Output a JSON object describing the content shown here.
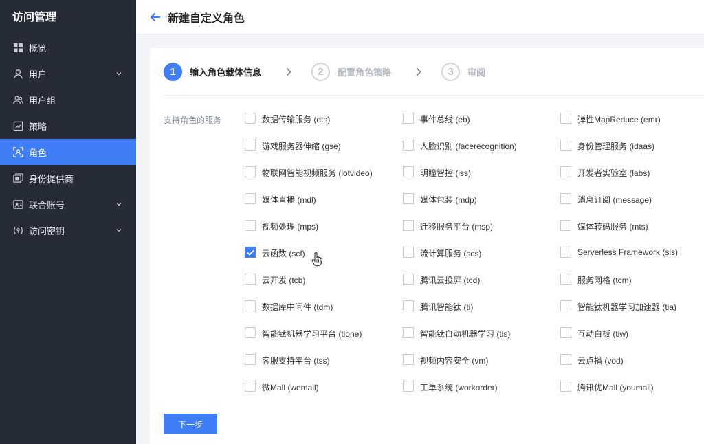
{
  "sidebar": {
    "title": "访问管理",
    "items": [
      {
        "label": "概览",
        "icon": "overview-icon"
      },
      {
        "label": "用户",
        "icon": "user-icon",
        "has_submenu": true
      },
      {
        "label": "用户组",
        "icon": "user-group-icon"
      },
      {
        "label": "策略",
        "icon": "policy-icon"
      },
      {
        "label": "角色",
        "icon": "role-icon",
        "active": true
      },
      {
        "label": "身份提供商",
        "icon": "identity-provider-icon"
      },
      {
        "label": "联合账号",
        "icon": "federated-account-icon",
        "has_submenu": true
      },
      {
        "label": "访问密钥",
        "icon": "access-key-icon",
        "has_submenu": true
      }
    ]
  },
  "header": {
    "back_icon": "back-arrow-icon",
    "title": "新建自定义角色"
  },
  "steps": [
    {
      "num": "1",
      "label": "输入角色载体信息",
      "state": "active"
    },
    {
      "num": "2",
      "label": "配置角色策略",
      "state": "inactive"
    },
    {
      "num": "3",
      "label": "审阅",
      "state": "inactive"
    }
  ],
  "form": {
    "services_label": "支持角色的服务",
    "services": [
      {
        "label": "数据传输服务 (dts)",
        "checked": false
      },
      {
        "label": "事件总线 (eb)",
        "checked": false
      },
      {
        "label": "弹性MapReduce (emr)",
        "checked": false
      },
      {
        "label": "游戏服务器伸缩 (gse)",
        "checked": false
      },
      {
        "label": "人脸识别 (facerecognition)",
        "checked": false
      },
      {
        "label": "身份管理服务 (idaas)",
        "checked": false
      },
      {
        "label": "物联网智能视频服务 (iotvideo)",
        "checked": false
      },
      {
        "label": "明瞳智控 (iss)",
        "checked": false
      },
      {
        "label": "开发者实验室 (labs)",
        "checked": false
      },
      {
        "label": "媒体直播 (mdl)",
        "checked": false
      },
      {
        "label": "媒体包装 (mdp)",
        "checked": false
      },
      {
        "label": "消息订阅 (message)",
        "checked": false
      },
      {
        "label": "视频处理 (mps)",
        "checked": false
      },
      {
        "label": "迁移服务平台 (msp)",
        "checked": false
      },
      {
        "label": "媒体转码服务 (mts)",
        "checked": false
      },
      {
        "label": "云函数 (scf)",
        "checked": true
      },
      {
        "label": "流计算服务 (scs)",
        "checked": false
      },
      {
        "label": "Serverless Framework (sls)",
        "checked": false
      },
      {
        "label": "云开发 (tcb)",
        "checked": false
      },
      {
        "label": "腾讯云投屏 (tcd)",
        "checked": false
      },
      {
        "label": "服务网格 (tcm)",
        "checked": false
      },
      {
        "label": "数据库中间件 (tdm)",
        "checked": false
      },
      {
        "label": "腾讯智能钛 (ti)",
        "checked": false
      },
      {
        "label": "智能钛机器学习加速器 (tia)",
        "checked": false
      },
      {
        "label": "智能钛机器学习平台 (tione)",
        "checked": false
      },
      {
        "label": "智能钛自动机器学习 (tis)",
        "checked": false
      },
      {
        "label": "互动白板 (tiw)",
        "checked": false
      },
      {
        "label": "客服支持平台 (tss)",
        "checked": false
      },
      {
        "label": "视频内容安全 (vm)",
        "checked": false
      },
      {
        "label": "云点播 (vod)",
        "checked": false
      },
      {
        "label": "微Mall (wemall)",
        "checked": false
      },
      {
        "label": "工单系统 (workorder)",
        "checked": false
      },
      {
        "label": "腾讯优Mall (youmall)",
        "checked": false
      }
    ],
    "next_label": "下一步"
  },
  "colors": {
    "sidebar_bg": "#262b38",
    "accent": "#3f7ef6",
    "page_bg": "#f3f4f7"
  }
}
